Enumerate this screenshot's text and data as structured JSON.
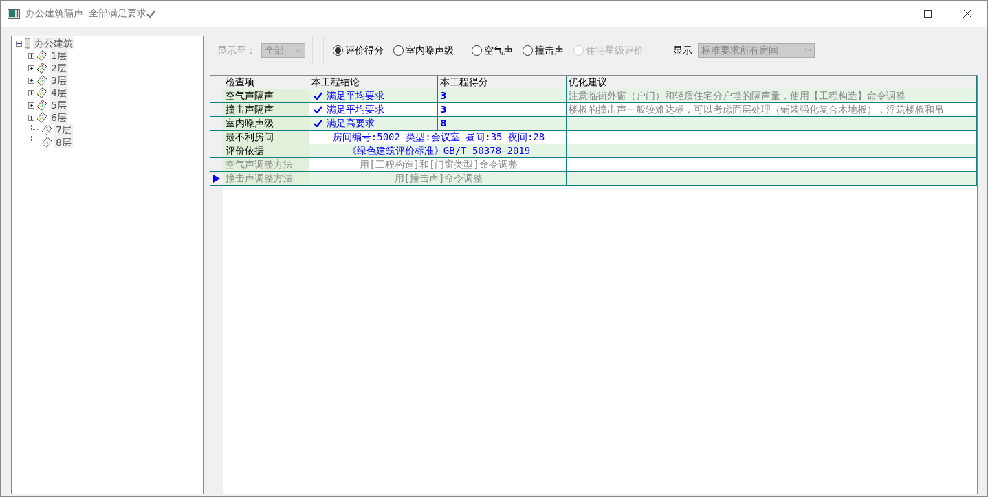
{
  "window": {
    "title": "办公建筑隔声",
    "status": "全部满足要求",
    "status_ok": true
  },
  "tree": {
    "label": "办公建筑",
    "expanded": true,
    "children": [
      {
        "label": "1层",
        "has_children": true
      },
      {
        "label": "2层",
        "has_children": true
      },
      {
        "label": "3层",
        "has_children": true
      },
      {
        "label": "4层",
        "has_children": true
      },
      {
        "label": "5层",
        "has_children": true
      },
      {
        "label": "6层",
        "has_children": true
      },
      {
        "label": "7层",
        "has_children": false
      },
      {
        "label": "8层",
        "has_children": false
      }
    ]
  },
  "show_to": {
    "label": "显示至：",
    "value": "全部",
    "disabled": true
  },
  "modes": [
    {
      "label": "评价得分",
      "selected": true,
      "disabled": false
    },
    {
      "label": "室内噪声级",
      "selected": false,
      "disabled": false
    },
    {
      "label": "空气声",
      "selected": false,
      "disabled": false
    },
    {
      "label": "撞击声",
      "selected": false,
      "disabled": false
    },
    {
      "label": "住宅星级评价",
      "selected": false,
      "disabled": true
    }
  ],
  "display": {
    "label": "显示",
    "value": "标准要求所有房间",
    "disabled": true
  },
  "table": {
    "columns": [
      "检查项",
      "本工程结论",
      "本工程得分",
      "优化建议"
    ],
    "rows": [
      {
        "kind": "split",
        "item": "空气声隔声",
        "passed": true,
        "conclusion": "满足平均要求",
        "score": "3",
        "advice": "注意临街外窗（户门）和轻质住宅分户墙的隔声量，使用【工程构造】命令调整",
        "disabled": false,
        "selected": false
      },
      {
        "kind": "split",
        "item": "撞击声隔声",
        "passed": true,
        "conclusion": "满足平均要求",
        "score": "3",
        "advice": "楼板的撞击声一般较难达标，可以考虑面层处理（铺装强化复合木地板），浮筑楼板和吊",
        "disabled": false,
        "selected": false
      },
      {
        "kind": "split",
        "item": "室内噪声级",
        "passed": true,
        "conclusion": "满足高要求",
        "score": "8",
        "disabled": false,
        "selected": false
      },
      {
        "kind": "merged",
        "item": "最不利房间",
        "text": "房间编号:5002 类型:会议室 昼间:35 夜间:28",
        "disabled": false,
        "selected": false
      },
      {
        "kind": "merged",
        "item": "评价依据",
        "text": "《绿色建筑评价标准》GB/T 50378-2019",
        "disabled": false,
        "selected": false
      },
      {
        "kind": "merged",
        "item": "空气声调整方法",
        "text": "用[工程构造]和[门窗类型]命令调整",
        "disabled": true,
        "selected": false
      },
      {
        "kind": "merged",
        "item": "撞击声调整方法",
        "text": "用[撞击声]命令调整",
        "disabled": true,
        "selected": true
      }
    ]
  }
}
